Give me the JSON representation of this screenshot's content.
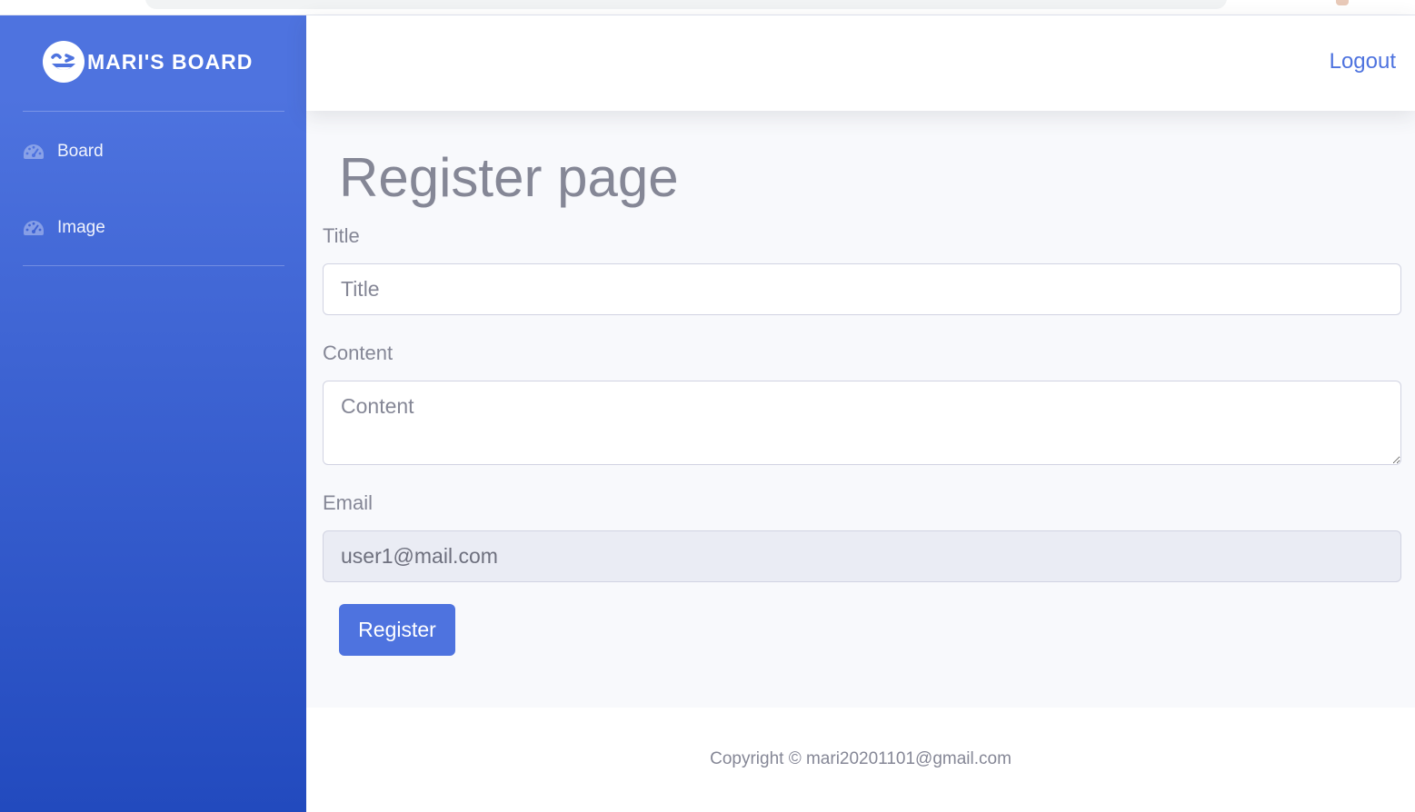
{
  "sidebar": {
    "brand_name": "MARI'S BOARD",
    "brand_icon": "laughing-face-icon",
    "items": [
      {
        "label": "Board",
        "icon": "tachometer-icon"
      },
      {
        "label": "Image",
        "icon": "tachometer-icon"
      }
    ],
    "gradient_top": "#4e73df",
    "gradient_bottom": "#224abe"
  },
  "topbar": {
    "logout_label": "Logout"
  },
  "main": {
    "page_title": "Register page",
    "form": {
      "title_label": "Title",
      "title_placeholder": "Title",
      "title_value": "",
      "content_label": "Content",
      "content_placeholder": "Content",
      "content_value": "",
      "email_label": "Email",
      "email_value": "user1@mail.com",
      "submit_label": "Register"
    }
  },
  "footer": {
    "copyright": "Copyright © mari20201101@gmail.com"
  },
  "colors": {
    "primary": "#4e73df",
    "text_muted": "#858796",
    "content_bg": "#f8f9fc",
    "readonly_bg": "#eaecf4"
  }
}
